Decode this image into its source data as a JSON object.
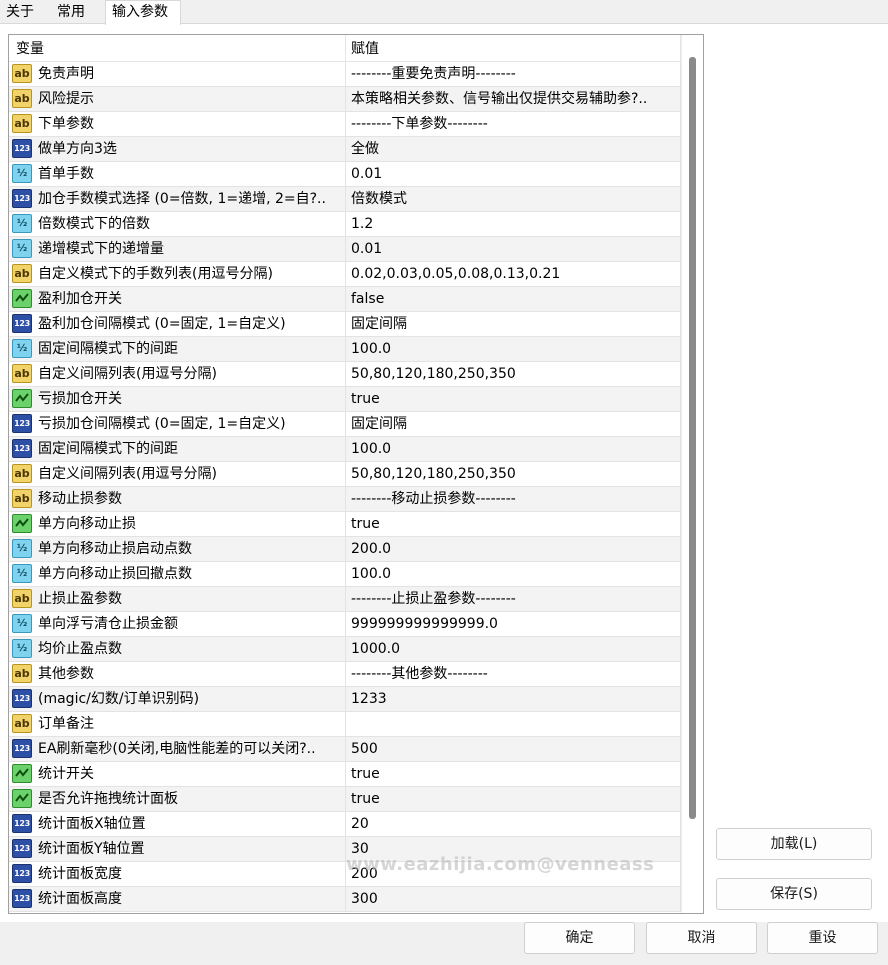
{
  "tabs": [
    {
      "label": "关于"
    },
    {
      "label": "常用"
    },
    {
      "label": "输入参数"
    }
  ],
  "grid": {
    "headers": {
      "variable": "变量",
      "value": "赋值"
    },
    "rows": [
      {
        "type": "ab",
        "name": "免责声明",
        "value": "--------重要免责声明--------"
      },
      {
        "type": "ab",
        "name": "风险提示",
        "value": "本策略相关参数、信号输出仅提供交易辅助参?.."
      },
      {
        "type": "ab",
        "name": "下单参数",
        "value": "--------下单参数--------"
      },
      {
        "type": "123",
        "name": "做单方向3选",
        "value": "全做"
      },
      {
        "type": "frac",
        "name": "首单手数",
        "value": "0.01"
      },
      {
        "type": "123",
        "name": "加仓手数模式选择 (0=倍数, 1=递增, 2=自?..",
        "value": "倍数模式"
      },
      {
        "type": "frac",
        "name": "倍数模式下的倍数",
        "value": "1.2"
      },
      {
        "type": "frac",
        "name": "递增模式下的递增量",
        "value": "0.01"
      },
      {
        "type": "ab",
        "name": "自定义模式下的手数列表(用逗号分隔)",
        "value": "0.02,0.03,0.05,0.08,0.13,0.21"
      },
      {
        "type": "bool",
        "name": "盈利加仓开关",
        "value": "false"
      },
      {
        "type": "123",
        "name": "盈利加仓间隔模式 (0=固定, 1=自定义)",
        "value": "固定间隔"
      },
      {
        "type": "frac",
        "name": "固定间隔模式下的间距",
        "value": "100.0"
      },
      {
        "type": "ab",
        "name": "自定义间隔列表(用逗号分隔)",
        "value": "50,80,120,180,250,350"
      },
      {
        "type": "bool",
        "name": "亏损加仓开关",
        "value": "true"
      },
      {
        "type": "123",
        "name": "亏损加仓间隔模式 (0=固定, 1=自定义)",
        "value": "固定间隔"
      },
      {
        "type": "123",
        "name": "固定间隔模式下的间距",
        "value": "100.0"
      },
      {
        "type": "ab",
        "name": "自定义间隔列表(用逗号分隔)",
        "value": "50,80,120,180,250,350"
      },
      {
        "type": "ab",
        "name": "移动止损参数",
        "value": "--------移动止损参数--------"
      },
      {
        "type": "bool",
        "name": "单方向移动止损",
        "value": "true"
      },
      {
        "type": "frac",
        "name": "单方向移动止损启动点数",
        "value": "200.0"
      },
      {
        "type": "frac",
        "name": "单方向移动止损回撤点数",
        "value": "100.0"
      },
      {
        "type": "ab",
        "name": "止损止盈参数",
        "value": "--------止损止盈参数--------"
      },
      {
        "type": "frac",
        "name": "单向浮亏清仓止损金额",
        "value": "999999999999999.0"
      },
      {
        "type": "frac",
        "name": "均价止盈点数",
        "value": "1000.0"
      },
      {
        "type": "ab",
        "name": "其他参数",
        "value": "--------其他参数--------"
      },
      {
        "type": "123",
        "name": "(magic/幻数/订单识别码)",
        "value": "1233"
      },
      {
        "type": "ab",
        "name": "订单备注",
        "value": ""
      },
      {
        "type": "123",
        "name": "EA刷新毫秒(0关闭,电脑性能差的可以关闭?..",
        "value": "500"
      },
      {
        "type": "bool",
        "name": "统计开关",
        "value": "true"
      },
      {
        "type": "bool",
        "name": "是否允许拖拽统计面板",
        "value": "true"
      },
      {
        "type": "123",
        "name": "统计面板X轴位置",
        "value": "20"
      },
      {
        "type": "123",
        "name": "统计面板Y轴位置",
        "value": "30"
      },
      {
        "type": "123",
        "name": "统计面板宽度",
        "value": "200"
      },
      {
        "type": "123",
        "name": "统计面板高度",
        "value": "300"
      }
    ]
  },
  "buttons": {
    "load": "加载(L)",
    "save": "保存(S)",
    "ok": "确定",
    "cancel": "取消",
    "reset": "重设"
  },
  "watermark": "www.eazhijia.com@venneass",
  "icon_labels": {
    "ab": "ab",
    "123": "123",
    "frac": "½"
  }
}
